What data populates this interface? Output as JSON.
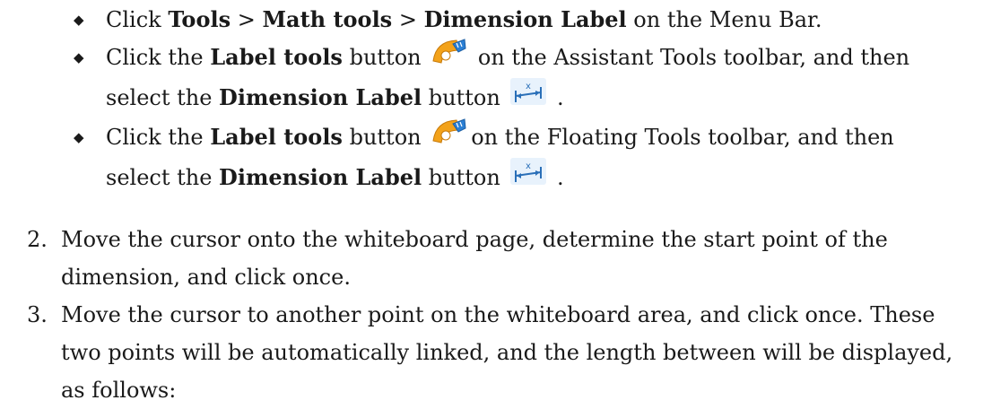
{
  "bullets": [
    {
      "mark": "◆",
      "p1": "Click ",
      "b1": "Tools",
      "p2": " > ",
      "b2": "Math tools",
      "p3": " > ",
      "b3": "Dimension Label",
      "p4": " on the Menu Bar."
    },
    {
      "mark": "◆",
      "p1": "Click the ",
      "b1": "Label tools",
      "p2": " button ",
      "icon1": "label-tools-icon",
      "p3": " on the Assistant Tools toolbar, and then select the ",
      "b2": "Dimension Label",
      "p4": " button ",
      "icon2": "dimension-label-icon",
      "p5": " ."
    },
    {
      "mark": "◆",
      "p1": "Click the ",
      "b1": "Label tools",
      "p2": " button ",
      "icon1": "label-tools-icon",
      "p3": "on the Floating Tools toolbar, and then select the ",
      "b2": "Dimension Label",
      "p4": " button ",
      "icon2": "dimension-label-icon",
      "p5": " ."
    }
  ],
  "steps": [
    {
      "number": "2.",
      "text": "Move the cursor onto the whiteboard page, determine the start point of the dimension, and click once."
    },
    {
      "number": "3.",
      "text": "Move the cursor to another point on the whiteboard area, and click once. These two points will be automatically linked, and the length between will be displayed, as follows:"
    }
  ]
}
